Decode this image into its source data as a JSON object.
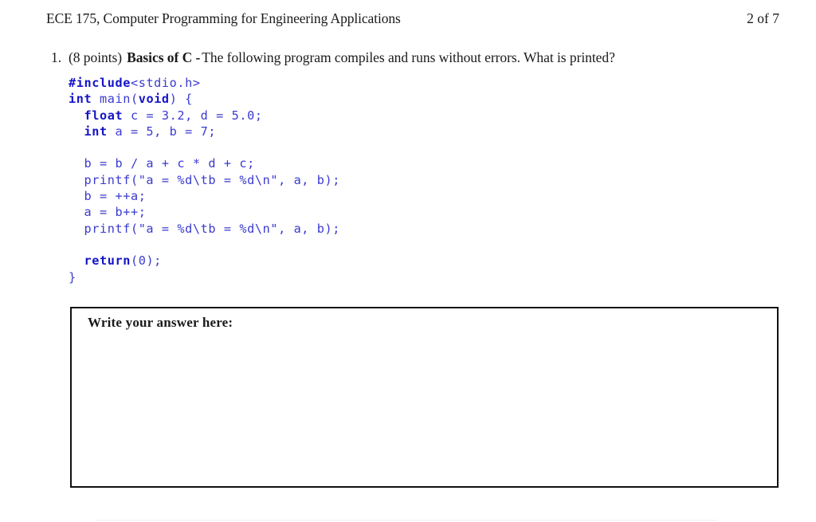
{
  "header": {
    "title": "ECE 175, Computer Programming for Engineering Applications",
    "page_indicator": "2 of 7"
  },
  "question": {
    "number": "1.",
    "points": "(8 points)",
    "topic": "Basics of C -",
    "prompt": "The following program compiles and runs without errors.  What is printed?"
  },
  "code": {
    "language": "c",
    "lines": [
      {
        "indent": 0,
        "tokens": [
          {
            "t": "#include",
            "k": true
          },
          {
            "t": "<stdio.h>",
            "k": false
          }
        ]
      },
      {
        "indent": 0,
        "tokens": [
          {
            "t": "int",
            "k": true
          },
          {
            "t": " main(",
            "k": false
          },
          {
            "t": "void",
            "k": true
          },
          {
            "t": ") {",
            "k": false
          }
        ]
      },
      {
        "indent": 2,
        "tokens": [
          {
            "t": "float",
            "k": true
          },
          {
            "t": " c = 3.2, d = 5.0;",
            "k": false
          }
        ]
      },
      {
        "indent": 2,
        "tokens": [
          {
            "t": "int",
            "k": true
          },
          {
            "t": " a = 5, b = 7;",
            "k": false
          }
        ]
      },
      {
        "indent": 0,
        "tokens": []
      },
      {
        "indent": 2,
        "tokens": [
          {
            "t": "b = b / a + c * d + c;",
            "k": false
          }
        ]
      },
      {
        "indent": 2,
        "tokens": [
          {
            "t": "printf(\"a = %d\\tb = %d\\n\", a, b);",
            "k": false
          }
        ]
      },
      {
        "indent": 2,
        "tokens": [
          {
            "t": "b = ++a;",
            "k": false
          }
        ]
      },
      {
        "indent": 2,
        "tokens": [
          {
            "t": "a = b++;",
            "k": false
          }
        ]
      },
      {
        "indent": 2,
        "tokens": [
          {
            "t": "printf(\"a = %d\\tb = %d\\n\", a, b);",
            "k": false
          }
        ]
      },
      {
        "indent": 0,
        "tokens": []
      },
      {
        "indent": 2,
        "tokens": [
          {
            "t": "return",
            "k": true
          },
          {
            "t": "(0);",
            "k": false
          }
        ]
      },
      {
        "indent": 0,
        "tokens": [
          {
            "t": "}",
            "k": false
          }
        ]
      }
    ],
    "keyword_color": "#1414c8",
    "body_color": "#3a3ad0"
  },
  "answer_box": {
    "label": "Write your answer here:",
    "value": "",
    "border_color": "#111111"
  }
}
